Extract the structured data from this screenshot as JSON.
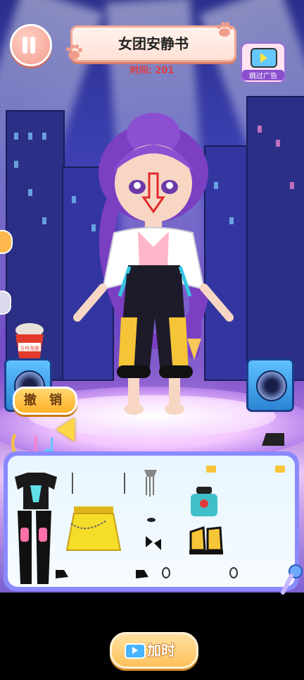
{
  "header": {
    "title": "女团安静书",
    "timer": "时间: 201",
    "skip_ad_label": "跳过广告"
  },
  "buttons": {
    "undo_label": "撤 销",
    "add_time_label": "加时"
  },
  "decor": {
    "noodle_cup_text": "方舟泡面"
  },
  "colors": {
    "timer_red": "#e33b3b",
    "panel_border": "#f3a896",
    "wardrobe_frame": "#8a8aff",
    "accent_yellow": "#ffc15a"
  },
  "wardrobe_items": [
    {
      "name": "crop-top"
    },
    {
      "name": "earring-a"
    },
    {
      "name": "earring-b"
    },
    {
      "name": "tassel-earring"
    },
    {
      "name": "hairclip-a"
    },
    {
      "name": "hairclip-b"
    },
    {
      "name": "thigh-boots"
    },
    {
      "name": "yellow-skirt"
    },
    {
      "name": "ring"
    },
    {
      "name": "bow-tie"
    },
    {
      "name": "teal-bag"
    },
    {
      "name": "sneakers"
    },
    {
      "name": "small-shoe-a"
    },
    {
      "name": "small-shoe-b"
    },
    {
      "name": "stud-a"
    },
    {
      "name": "stud-b"
    }
  ]
}
